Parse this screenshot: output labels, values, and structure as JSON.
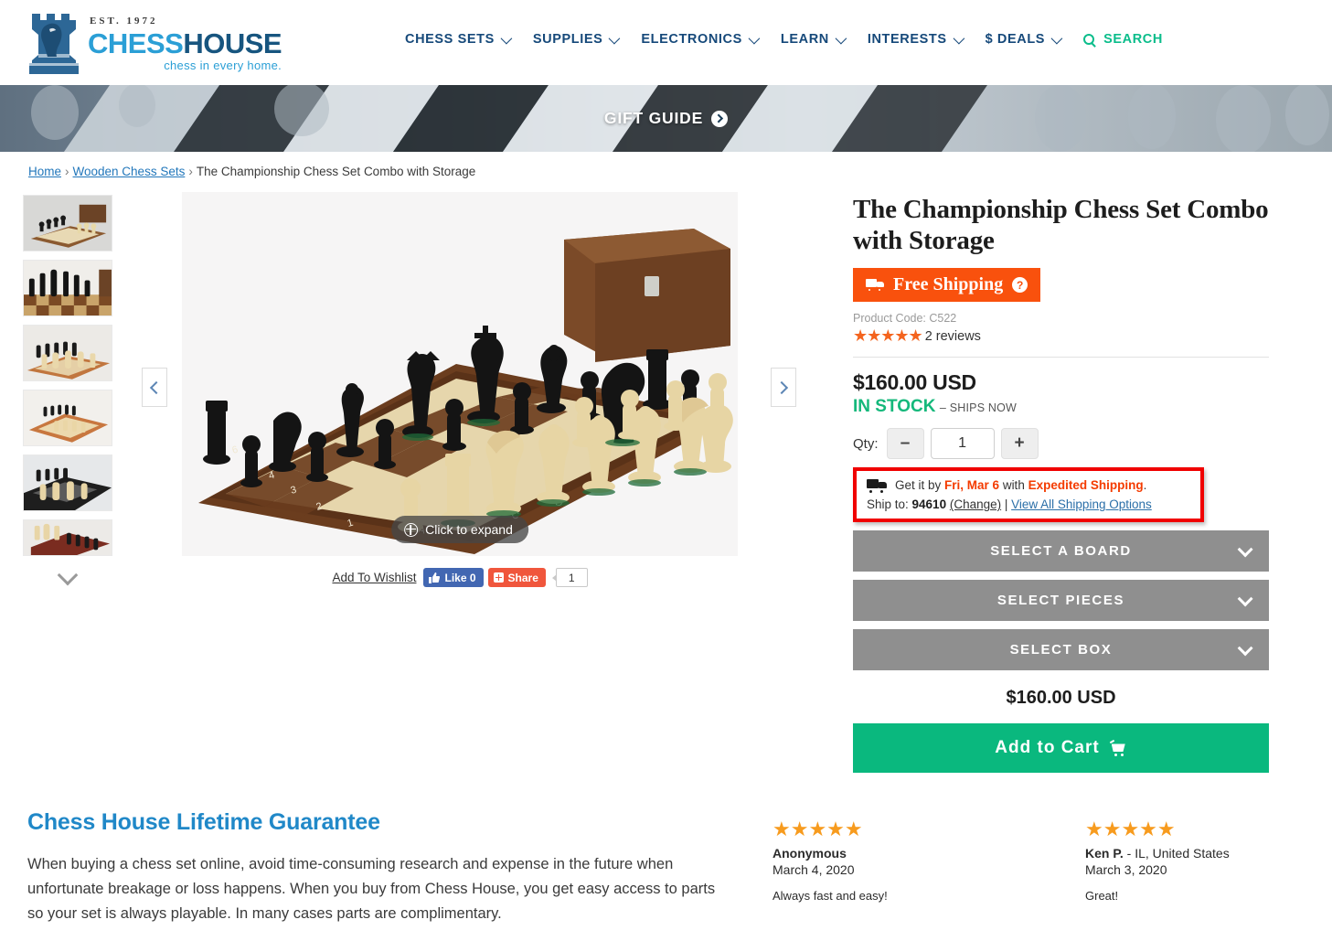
{
  "header": {
    "logo": {
      "est": "EST. 1972",
      "name_light": "CHESS",
      "name_dark": "HOUSE",
      "tagline": "chess in every home."
    },
    "nav": [
      {
        "label": "CHESS SETS",
        "caret": true
      },
      {
        "label": "SUPPLIES",
        "caret": true
      },
      {
        "label": "ELECTRONICS",
        "caret": true
      },
      {
        "label": "LEARN",
        "caret": true
      },
      {
        "label": "INTERESTS",
        "caret": true
      },
      {
        "label": "$ DEALS",
        "caret": true
      },
      {
        "label": "SEARCH",
        "caret": false
      }
    ]
  },
  "banner": {
    "label": "GIFT GUIDE"
  },
  "breadcrumb": {
    "home": "Home",
    "category": "Wooden Chess Sets",
    "current": "The Championship Chess Set Combo with Storage",
    "separator": "›"
  },
  "gallery": {
    "expand_label": "Click to expand",
    "prev_label": "Previous image",
    "next_label": "Next image",
    "more_label": "More thumbnails",
    "thumb_count": 6
  },
  "social": {
    "wishlist": "Add To Wishlist",
    "like_label": "Like 0",
    "share_label": "Share",
    "share_count": "1"
  },
  "product": {
    "title": "The Championship Chess Set Combo with Storage",
    "free_shipping_badge": "Free Shipping",
    "product_code": "Product Code: C522",
    "stars": "★★★★★",
    "reviews_link": "2 reviews",
    "price": "$160.00 USD",
    "stock": "IN STOCK",
    "ships": "– SHIPS NOW",
    "qty_label": "Qty:",
    "qty_value": "1",
    "qty_minus": "–",
    "qty_plus": "+",
    "total_price": "$160.00 USD",
    "add_to_cart": "Add to Cart",
    "selectors": [
      {
        "label": "SELECT A BOARD"
      },
      {
        "label": "SELECT PIECES"
      },
      {
        "label": "SELECT BOX"
      }
    ]
  },
  "shipping_box": {
    "get_it_by_prefix": "Get it by ",
    "date": "Fri, Mar 6",
    "with": " with ",
    "method": "Expedited Shipping",
    "period": ".",
    "ship_to_label": "Ship to: ",
    "zip": "94610",
    "change": "(Change)",
    "divider": " | ",
    "view_all": "View All Shipping Options"
  },
  "guarantee": {
    "title": "Chess House Lifetime Guarantee",
    "body": "When buying a chess set online, avoid time-consuming research and expense in the future when unfortunate breakage or loss happens. When you buy from Chess House, you get easy access to parts so your set is always playable. In many cases parts are complimentary."
  },
  "customer_reviews": [
    {
      "stars": "★★★★★",
      "name": "Anonymous",
      "location": "",
      "date": "March 4, 2020",
      "text": "Always fast and easy!"
    },
    {
      "stars": "★★★★★",
      "name": "Ken P.",
      "location": " - IL, United States",
      "date": "March 3, 2020",
      "text": "Great!"
    }
  ],
  "colors": {
    "brand_blue": "#16497a",
    "logo_light_blue": "#2b9fd6",
    "accent_green": "#0bbd8b",
    "cart_green": "#0ab87e",
    "shipping_orange": "#f9510d",
    "star_orange": "#f4641e",
    "review_star": "#f79b1e",
    "highlight_red": "#f00000",
    "selector_gray": "#8f8f8f",
    "guarantee_blue": "#2088c8"
  }
}
